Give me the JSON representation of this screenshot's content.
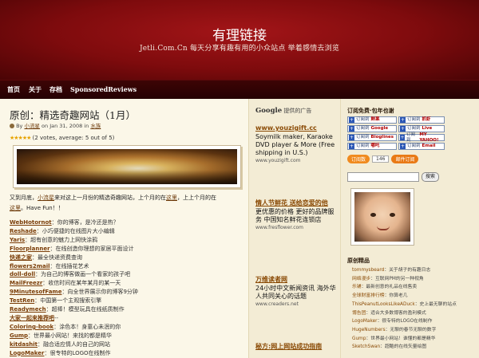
{
  "header": {
    "title": "有理链接",
    "description": "Jetli.Com.Cn 每天分享有趣有用的小众站点 举着感情去浏览"
  },
  "nav": [
    "首页",
    "关于",
    "存档",
    "SponsoredReviews"
  ],
  "post": {
    "title": "原创：精选奇趣网站（1月）",
    "meta_by": "By",
    "meta_author": "小流星",
    "meta_date_prefix": "on Jan 31, 2008 in",
    "meta_category": "水族",
    "rating_text": "(2 votes, average: 5 out of 5)",
    "intro_1": "又到月底，",
    "intro_link1": "小流星",
    "intro_2": "来对这上一月份的精选奇趣网站，上个月的在",
    "intro_link2": "这里",
    "intro_3": "，上上个月的在",
    "intro_link3": "这里",
    "intro_4": "。Have Fun！！"
  },
  "sites": [
    {
      "name": "WebHotornot",
      "desc": "：你的博客，是冷还是热？"
    },
    {
      "name": "Reshade",
      "desc": "：小巧便捷的在线图片大小编辑"
    },
    {
      "name": "Yaris",
      "desc": "：超有创意的魅力上网快涂鸦"
    },
    {
      "name": "Floorplanner",
      "desc": "：在线创造你理想的家居平面设计"
    },
    {
      "name": "快递之家",
      "desc": "：最全快递资费查询"
    },
    {
      "name": "flowers2mail",
      "desc": "：在线插花艺术"
    },
    {
      "name": "doll-doll",
      "desc": "：为自己的博客做画一个看家的孩子吧"
    },
    {
      "name": "MailFreezr",
      "desc": "：收信时间在某年某月的某一天"
    },
    {
      "name": "9MinutesofFame",
      "desc": "：向全世界展示你的博客9分钟"
    },
    {
      "name": "TestRen",
      "desc": "：中国第一个主观搜索引擎"
    },
    {
      "name": "Readymech",
      "desc": "：超棒！模型玩具在线纸质制作"
    },
    {
      "name": "大家一起来推荐吧",
      "desc": "--"
    },
    {
      "name": "Coloring-book",
      "desc": "：涂色本！身童心未泯的你"
    },
    {
      "name": "Gump",
      "desc": "：世界最小网站！来找的都是精华"
    },
    {
      "name": "kitdashit",
      "desc": "：融合适应情人的自己的网站"
    },
    {
      "name": "LogoMaker",
      "desc": "：很专特的LOGO在线制作"
    }
  ],
  "google": {
    "brand": "Google",
    "label": "提供的广告"
  },
  "ads": [
    {
      "title": "www.youzigift.cc",
      "body": "Soymilk maker, Karaoke DVD player & More (Free shipping in U.S.)",
      "url": "www.youzigift.com"
    },
    {
      "title": "情人节鲜花 送给恋爱的他",
      "body": "更优惠的价格 更好的品牌服务 中国知名鲜花连锁店",
      "url": "www.fresflower.com"
    },
    {
      "title": "万维读者网",
      "body": "24小时中文新闻资讯 海外华人共同关心的话题",
      "url": "www.creaders.net"
    },
    {
      "title": "秘方:网上网站成功指南",
      "body": "",
      "url": ""
    }
  ],
  "right": {
    "subscribe_title": "订阅免费·包年也谢",
    "subscribe_buttons": [
      [
        "订阅到",
        "鲜果",
        "订阅到",
        "抓虾"
      ],
      [
        "订阅到",
        "Google",
        "订阅到",
        "Live"
      ],
      [
        "订阅到",
        "Bloglines",
        "订阅到",
        "MY YAHOO!"
      ],
      [
        "订阅到",
        "哪吒",
        "订阅到",
        "Email"
      ]
    ],
    "feed_label": "订阅数",
    "feed_count": "146",
    "feed_email": "邮件订阅",
    "search_button": "搜索",
    "links_title": "原创精品",
    "links": [
      {
        "name": "tommysbeard",
        "desc": "：关于胡子的有趣日志"
      },
      {
        "name": "网络漫步",
        "desc": "：互联网PM的另一种视角"
      },
      {
        "name": "乐铺",
        "desc": "：最新创意的礼品在线售卖"
      },
      {
        "name": "全球财富排行榜",
        "desc": "：你算老几"
      },
      {
        "name": "ThisPeanutLooksLikeADuck",
        "desc": "：史上最无聊的站点"
      },
      {
        "name": "博告团",
        "desc": "：适合大多数博客的盈利模式"
      },
      {
        "name": "LogoMaker",
        "desc": "：很专特的LOGO在线制作"
      },
      {
        "name": "HugeNumbers",
        "desc": "：无聊的春节无聊的数字"
      },
      {
        "name": "Gump",
        "desc": "：世界最小网站！谁懂的都是精华"
      },
      {
        "name": "SketchSwan",
        "desc": "：超酷的在线矢量绘图"
      }
    ]
  }
}
